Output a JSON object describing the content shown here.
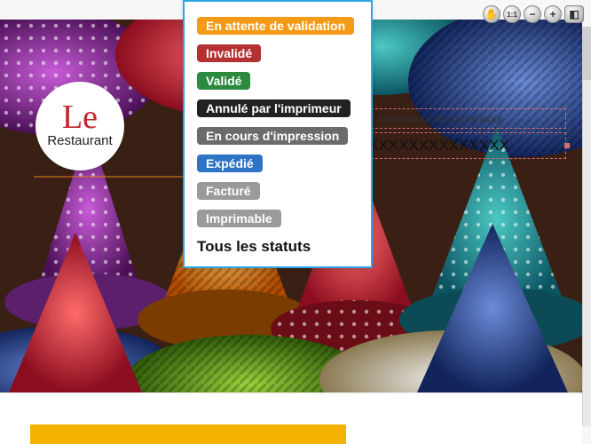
{
  "logo": {
    "script": "Le",
    "word": "Restaurant"
  },
  "fields": {
    "date_range": "u xx/xx/xxxx au xx/xx/xxxx",
    "code": "XXXXXXXXXXXXXX"
  },
  "dropdown": {
    "items": [
      {
        "label": "En attente de validation",
        "bg": "#f59a16"
      },
      {
        "label": "Invalidé",
        "bg": "#b53030"
      },
      {
        "label": "Validé",
        "bg": "#2a8a3e"
      },
      {
        "label": "Annulé par l'imprimeur",
        "bg": "#222222"
      },
      {
        "label": "En cours d'impression",
        "bg": "#6b6b6b"
      },
      {
        "label": "Expédié",
        "bg": "#2d74c4"
      },
      {
        "label": "Facturé",
        "bg": "#9a9a9a"
      },
      {
        "label": "Imprimable",
        "bg": "#9a9a9a"
      }
    ],
    "all_label": "Tous les statuts"
  },
  "toolbar": {
    "hand": "✋",
    "fit": "1:1",
    "zoom_out": "−",
    "zoom_in": "+",
    "panel": "◧"
  },
  "palette": {
    "dropdown_border": "#2aa6e6",
    "field_border": "#d07070",
    "bottom_accent": "#f6b200"
  }
}
